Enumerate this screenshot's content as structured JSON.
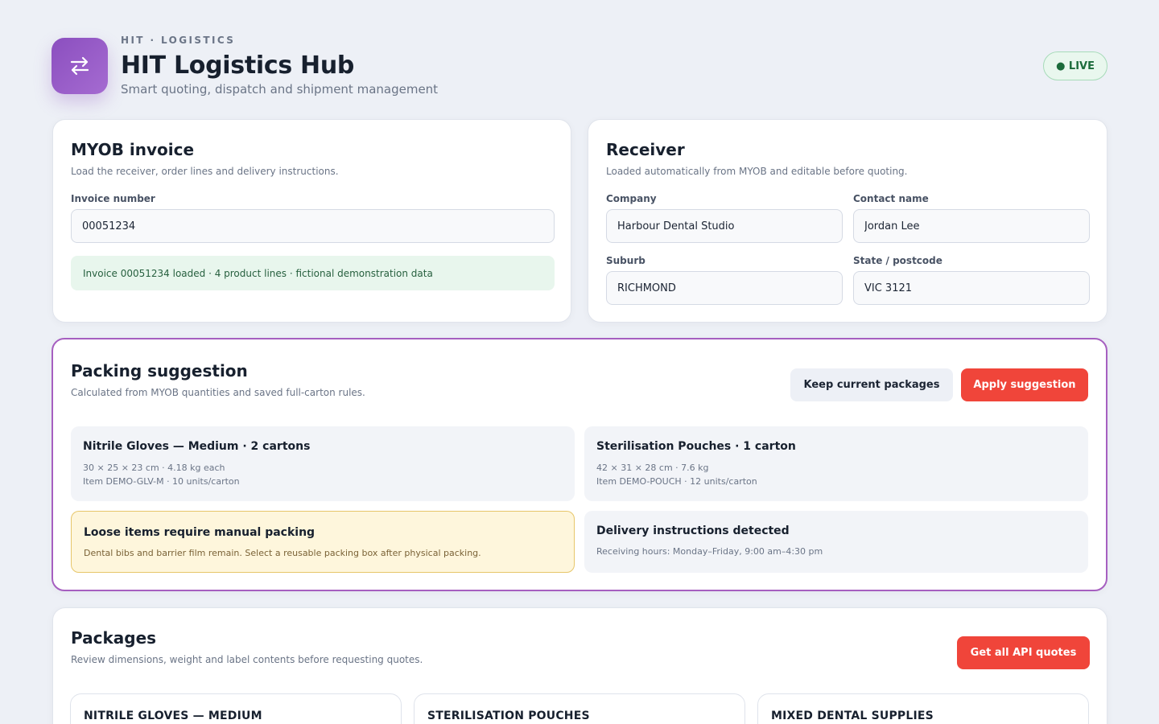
{
  "header": {
    "eyebrow": "HIT · LOGISTICS",
    "title": "HIT Logistics Hub",
    "subtitle": "Smart quoting, dispatch and shipment management",
    "logo_icon": "swap-arrows-icon",
    "status_badge": "● LIVE",
    "accent_color": "#9a5ac8"
  },
  "invoice": {
    "title": "MYOB invoice",
    "subtitle": "Load the receiver, order lines and delivery instructions.",
    "invoice_number_label": "Invoice number",
    "invoice_number_value": "00051234",
    "notice": "Invoice 00051234 loaded · 4 product lines · fictional demonstration data"
  },
  "receiver": {
    "title": "Receiver",
    "subtitle": "Loaded automatically from MYOB and editable before quoting.",
    "company_label": "Company",
    "company_value": "Harbour Dental Studio",
    "contact_label": "Contact name",
    "contact_value": "Jordan Lee",
    "suburb_label": "Suburb",
    "suburb_value": "RICHMOND",
    "state_label": "State / postcode",
    "state_value": "VIC 3121"
  },
  "packing": {
    "title": "Packing suggestion",
    "subtitle": "Calculated from MYOB quantities and saved full-carton rules.",
    "keep_button": "Keep current packages",
    "apply_button": "Apply suggestion",
    "items": [
      {
        "title": "Nitrile Gloves — Medium · 2 cartons",
        "line1": "30 × 25 × 23 cm · 4.18 kg each",
        "line2": "Item DEMO-GLV-M · 10 units/carton"
      },
      {
        "title": "Sterilisation Pouches · 1 carton",
        "line1": "42 × 31 × 28 cm · 7.6 kg",
        "line2": "Item DEMO-POUCH · 12 units/carton"
      }
    ],
    "warning": {
      "title": "Loose items require manual packing",
      "text": "Dental bibs and barrier film remain. Select a reusable packing box after physical packing."
    },
    "delivery": {
      "title": "Delivery instructions detected",
      "text": "Receiving hours: Monday–Friday, 9:00 am–4:30 pm"
    }
  },
  "packages": {
    "title": "Packages",
    "subtitle": "Review dimensions, weight and label contents before requesting quotes.",
    "quote_button": "Get all API quotes",
    "cards": [
      {
        "title": "NITRILE GLOVES — MEDIUM"
      },
      {
        "title": "STERILISATION POUCHES"
      },
      {
        "title": "MIXED DENTAL SUPPLIES"
      }
    ]
  }
}
